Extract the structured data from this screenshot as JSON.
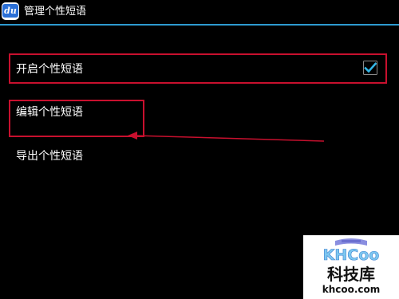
{
  "header": {
    "app_icon": "du-keyboard-icon",
    "app_icon_text": "du",
    "title": "管理个性短语"
  },
  "settings": {
    "items": [
      {
        "label": "开启个性短语",
        "checked": true
      },
      {
        "label": "编辑个性短语"
      },
      {
        "label": "导出个性短语"
      }
    ]
  },
  "annotations": {
    "highlight_color": "#c8102e",
    "arrow_color": "#c8102e"
  },
  "watermark": {
    "logo_text": "KHCoo",
    "cn_text": "科技库",
    "url": "khcoo.com"
  },
  "colors": {
    "background": "#000000",
    "accent": "#2d9ad0",
    "checkmark": "#33b5e5",
    "text": "#ffffff"
  }
}
